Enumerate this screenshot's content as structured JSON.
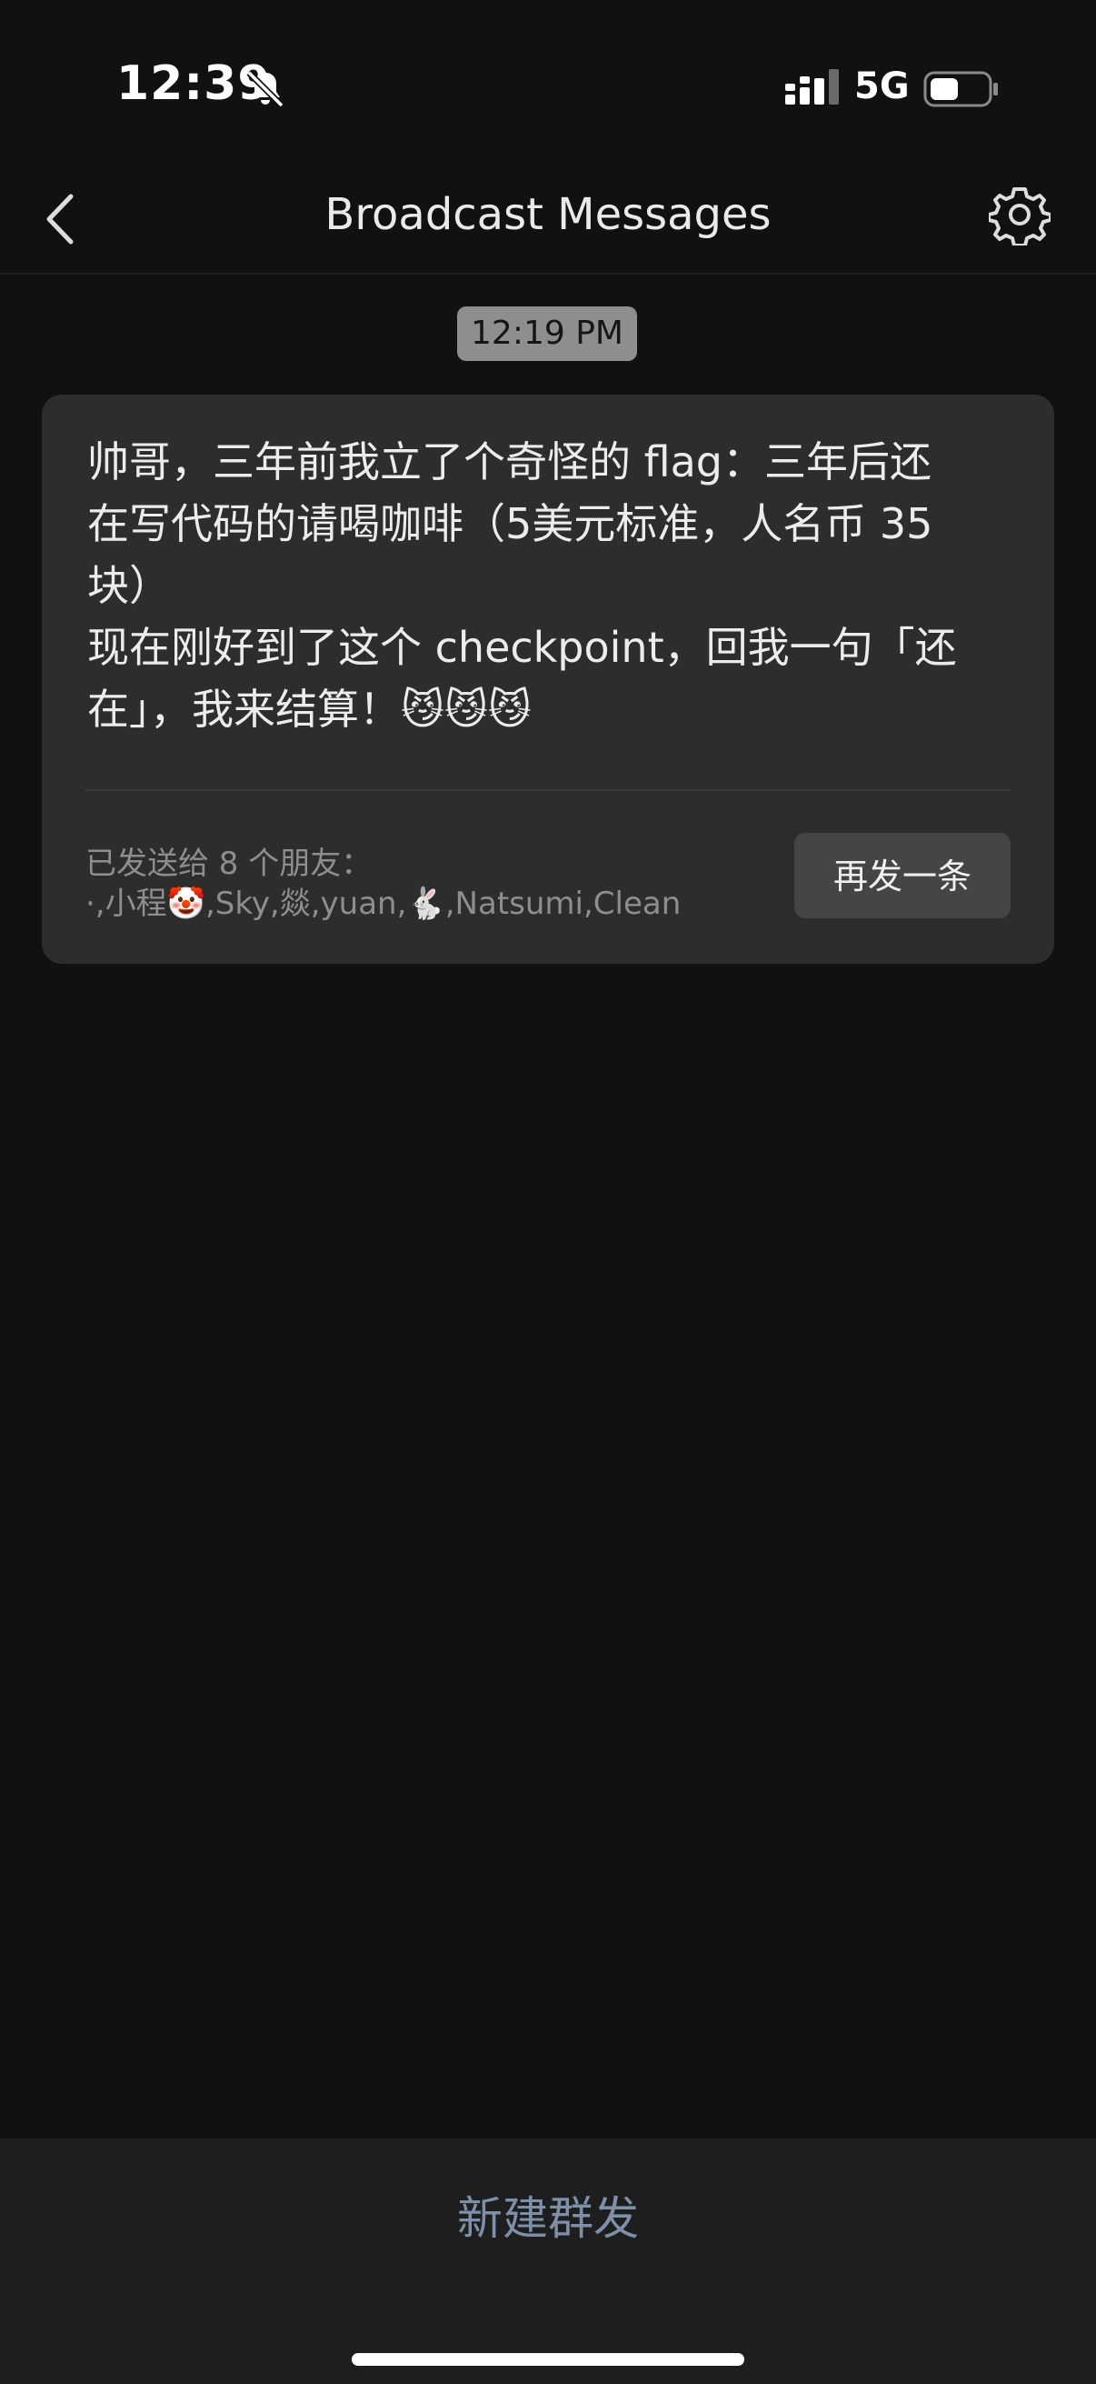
{
  "status_bar": {
    "time": "12:39",
    "network": "5G"
  },
  "nav": {
    "title": "Broadcast Messages"
  },
  "message": {
    "timestamp": "12:19 PM",
    "text": "帅哥，三年前我立了个奇怪的 flag：三年后还\n在写代码的请喝咖啡（5美元标准，人名币 35\n块）\n现在刚好到了这个 checkpoint，回我一句「还\n在」，我来结算！😼😼😼",
    "recipients_label": "已发送给 8 个朋友：",
    "recipients_list": "·,小程🤡,Sky,燚,yuan,🐇,Natsumi,Clean",
    "resend_label": "再发一条"
  },
  "bottom": {
    "new_broadcast_label": "新建群发"
  },
  "colors": {
    "background": "#111111",
    "card": "#2d2d2d",
    "accent_link": "#7d90a8"
  }
}
